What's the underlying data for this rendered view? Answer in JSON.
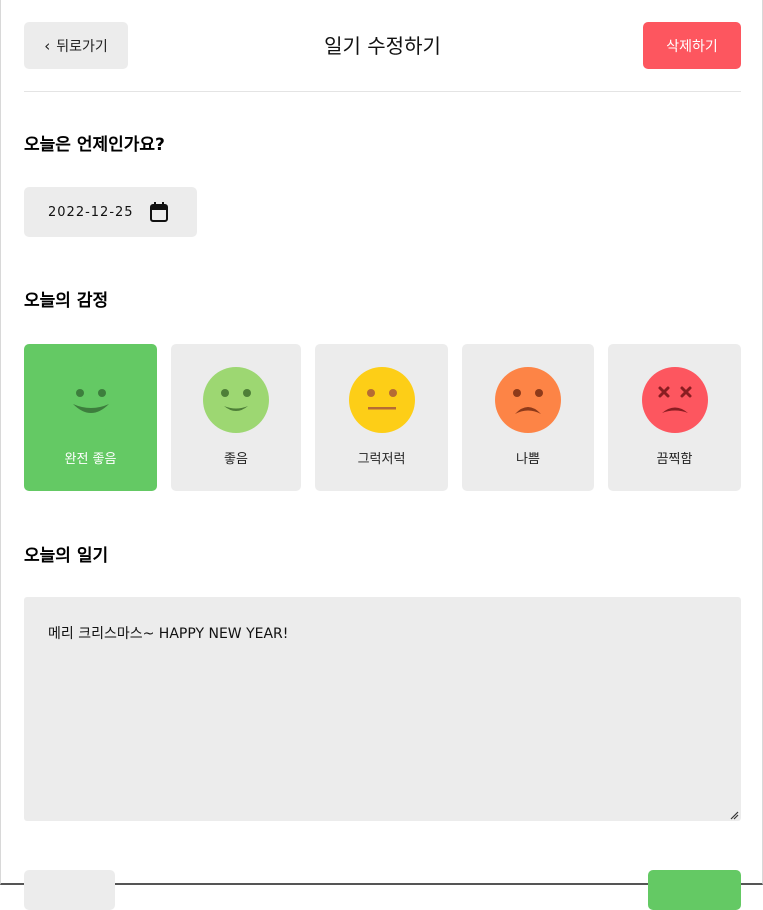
{
  "header": {
    "back_label": "뒤로가기",
    "title": "일기 수정하기",
    "delete_label": "삭제하기"
  },
  "date_section": {
    "label": "오늘은 언제인가요?",
    "value": "2022-12-25"
  },
  "emotion_section": {
    "label": "오늘의 감정",
    "options": [
      {
        "label": "완전 좋음",
        "selected": true,
        "icon": "very-happy-face-icon",
        "color": "#64c964"
      },
      {
        "label": "좋음",
        "selected": false,
        "icon": "happy-face-icon",
        "color": "#9dd772"
      },
      {
        "label": "그럭저럭",
        "selected": false,
        "icon": "neutral-face-icon",
        "color": "#fdce17"
      },
      {
        "label": "나쁨",
        "selected": false,
        "icon": "sad-face-icon",
        "color": "#fd8446"
      },
      {
        "label": "끔찍함",
        "selected": false,
        "icon": "angry-face-icon",
        "color": "#fd565f"
      }
    ]
  },
  "diary_section": {
    "label": "오늘의 일기",
    "content": "메리 크리스마스~ HAPPY NEW YEAR!"
  },
  "colors": {
    "accent_green": "#64c964",
    "danger_red": "#fd565f",
    "box_gray": "#ececec"
  }
}
